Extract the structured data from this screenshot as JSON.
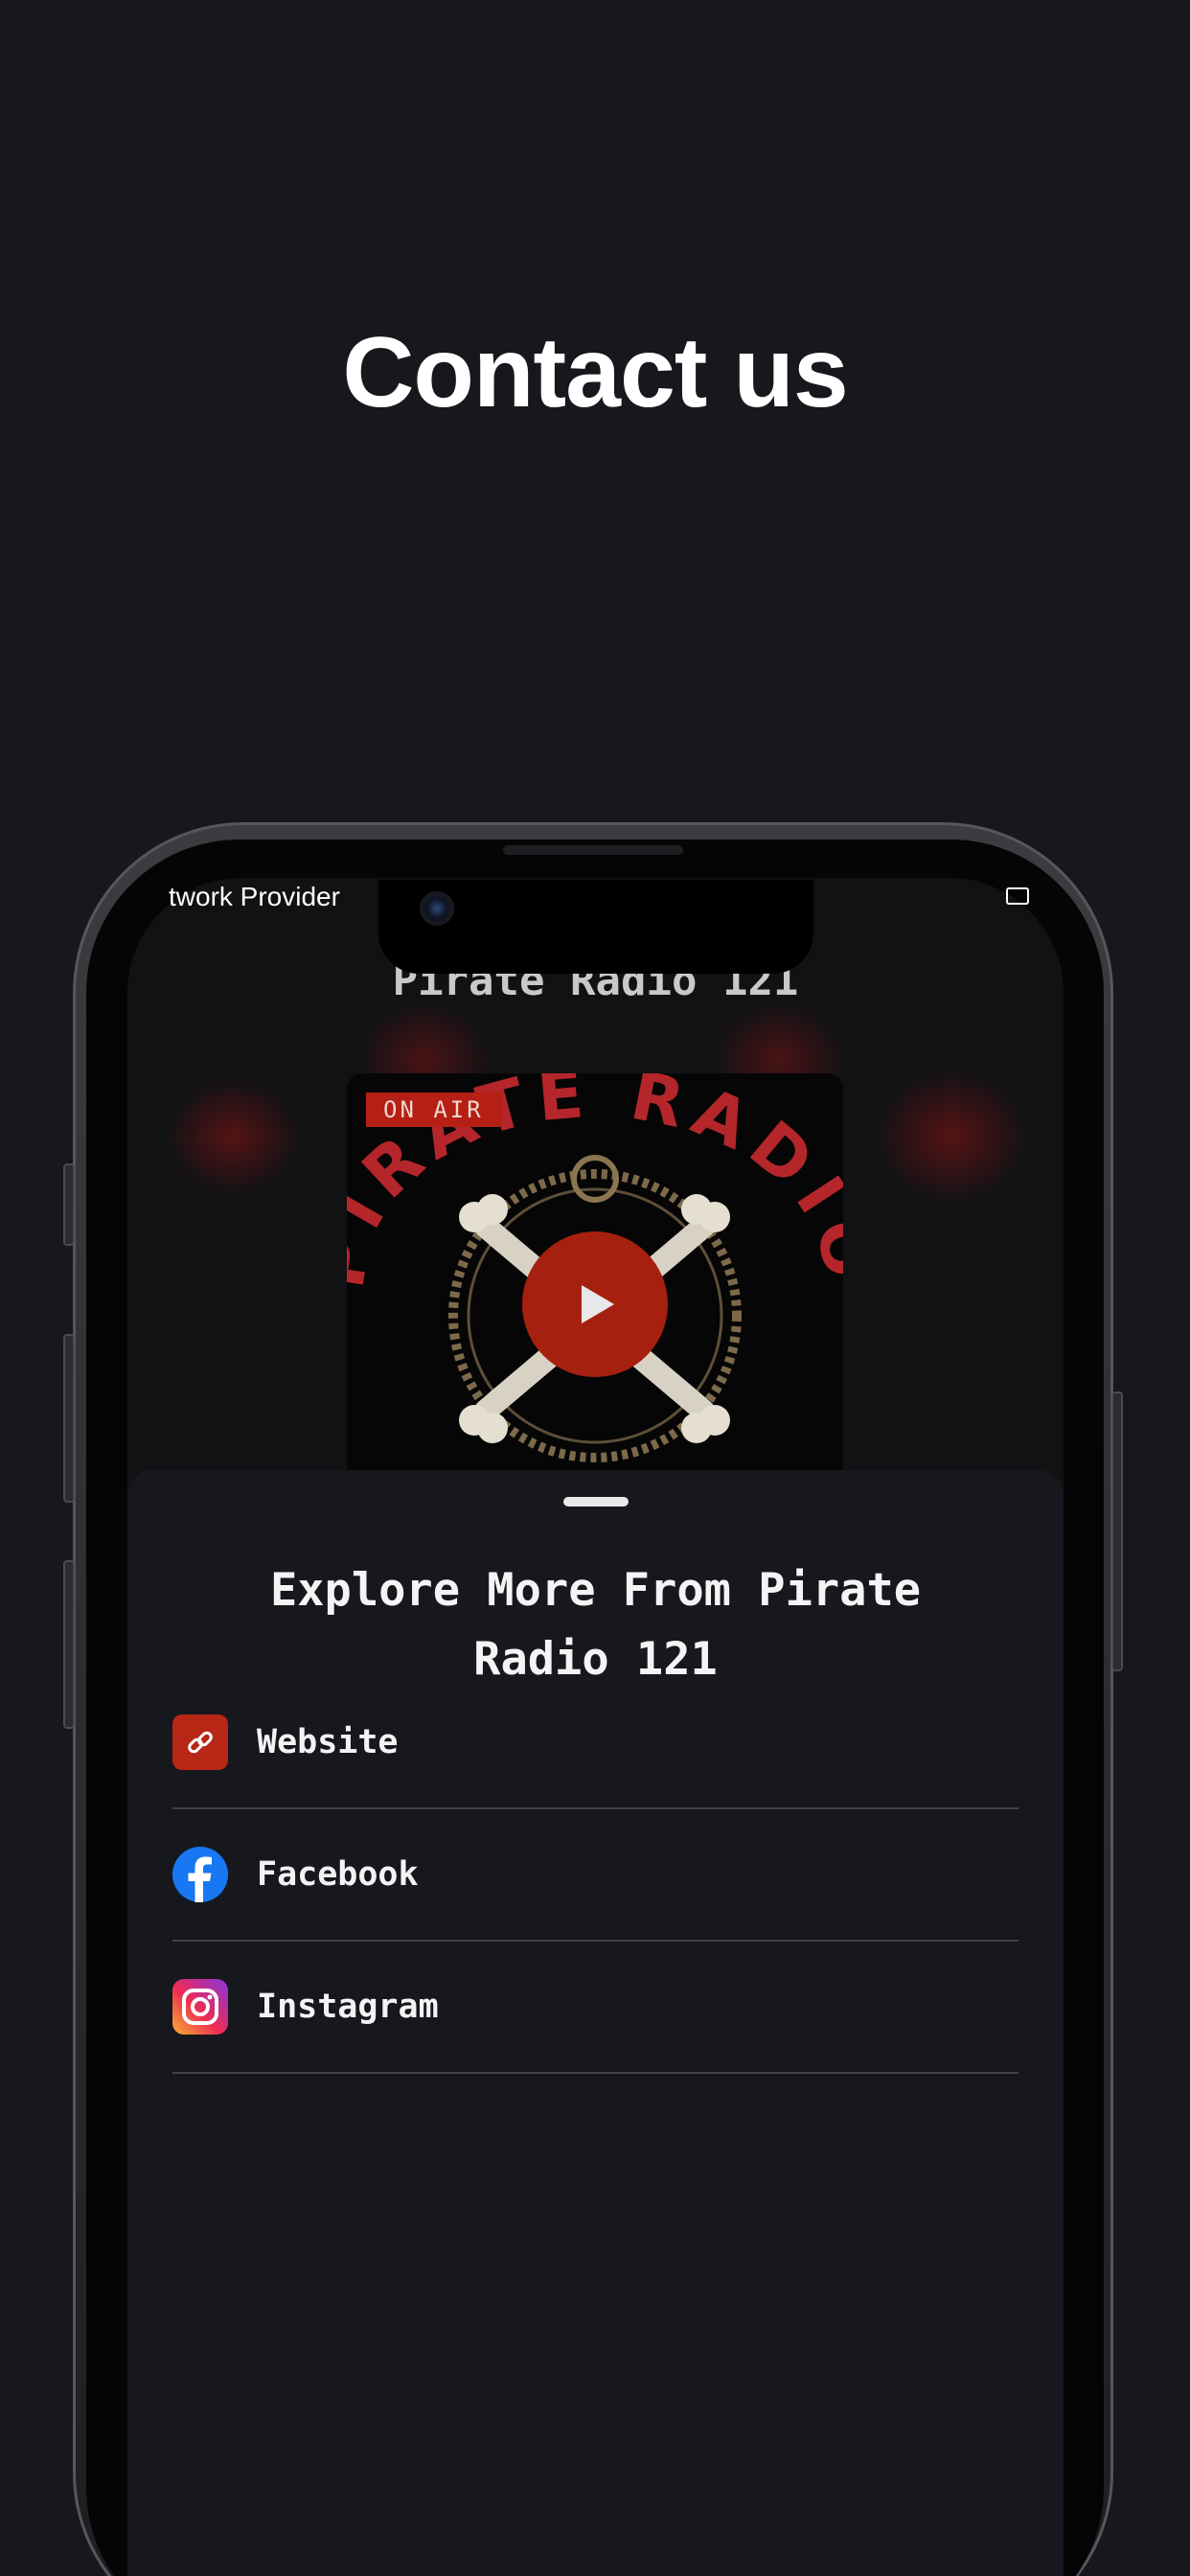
{
  "page": {
    "headline": "Contact us"
  },
  "status_bar": {
    "carrier": "twork Provider"
  },
  "app": {
    "title": "Pirate Radio 121",
    "artwork_badge": "ON AIR",
    "artwork_text": "PIRATE RADIO",
    "accent_color": "#b51f14"
  },
  "sheet": {
    "title": "Explore More From Pirate Radio 121",
    "links": [
      {
        "label": "Website",
        "icon": "link-icon"
      },
      {
        "label": "Facebook",
        "icon": "facebook-icon"
      },
      {
        "label": "Instagram",
        "icon": "instagram-icon"
      }
    ]
  }
}
